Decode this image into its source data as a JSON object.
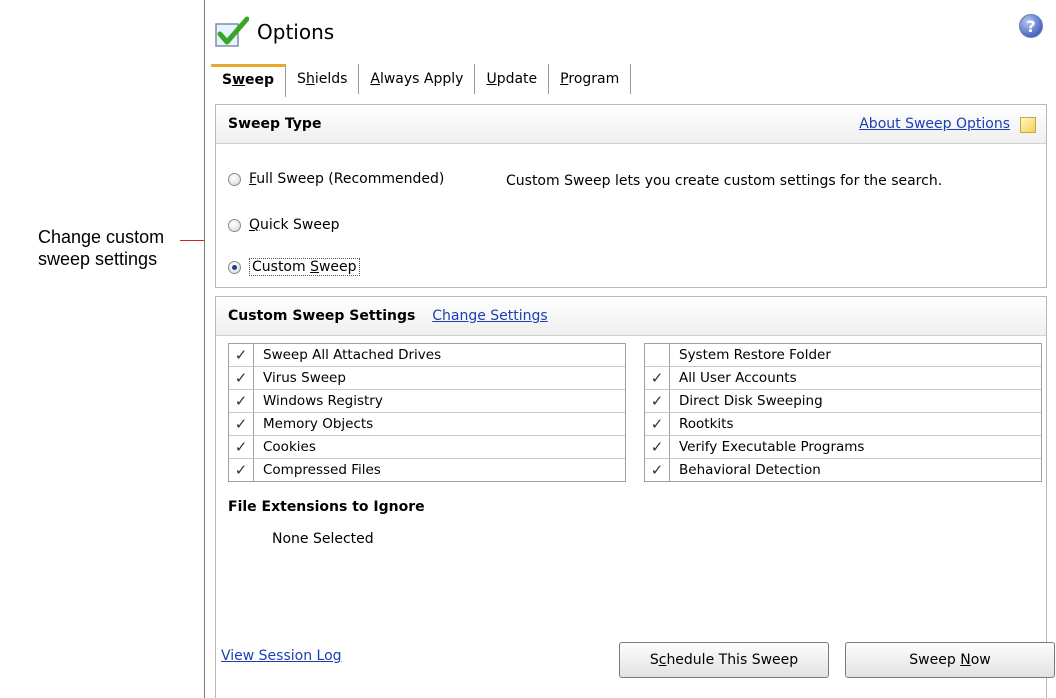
{
  "annotation": {
    "text": "Change custom sweep settings"
  },
  "window": {
    "title": "Options",
    "help": "?"
  },
  "tabs": [
    {
      "label_pre": "S",
      "label_u": "w",
      "label_post": "eep",
      "active": true
    },
    {
      "label_pre": "S",
      "label_u": "h",
      "label_post": "ields"
    },
    {
      "label_pre": "",
      "label_u": "A",
      "label_post": "lways Apply"
    },
    {
      "label_pre": "",
      "label_u": "U",
      "label_post": "pdate"
    },
    {
      "label_pre": "",
      "label_u": "P",
      "label_post": "rogram"
    }
  ],
  "sweep_type": {
    "title": "Sweep Type",
    "about_link": "About Sweep Options",
    "description": "Custom Sweep lets you create custom settings for the search.",
    "options": [
      {
        "u": "F",
        "rest": "ull Sweep (Recommended)",
        "selected": false
      },
      {
        "u": "Q",
        "rest": "uick Sweep",
        "selected": false
      },
      {
        "pre": "Custom ",
        "u": "S",
        "rest": "weep",
        "selected": true
      }
    ]
  },
  "custom_settings": {
    "title": "Custom Sweep Settings",
    "change_link": "Change Settings",
    "left_items": [
      {
        "label": "Sweep All Attached Drives",
        "checked": true
      },
      {
        "label": "Virus Sweep",
        "checked": true
      },
      {
        "label": "Windows Registry",
        "checked": true
      },
      {
        "label": "Memory Objects",
        "checked": true
      },
      {
        "label": "Cookies",
        "checked": true
      },
      {
        "label": "Compressed Files",
        "checked": true
      }
    ],
    "right_items": [
      {
        "label": "System Restore Folder",
        "checked": false
      },
      {
        "label": "All User Accounts",
        "checked": true
      },
      {
        "label": "Direct Disk Sweeping",
        "checked": true
      },
      {
        "label": "Rootkits",
        "checked": true
      },
      {
        "label": "Verify Executable Programs",
        "checked": true
      },
      {
        "label": "Behavioral Detection",
        "checked": true
      }
    ],
    "check_glyph": "✓",
    "extensions_title": "File Extensions to Ignore",
    "extensions_value": "None Selected"
  },
  "footer": {
    "view_log": "View Session Log",
    "schedule": {
      "pre": "S",
      "u": "c",
      "post": "hedule This Sweep"
    },
    "sweep_now": {
      "pre": "Sweep ",
      "u": "N",
      "post": "ow"
    }
  }
}
